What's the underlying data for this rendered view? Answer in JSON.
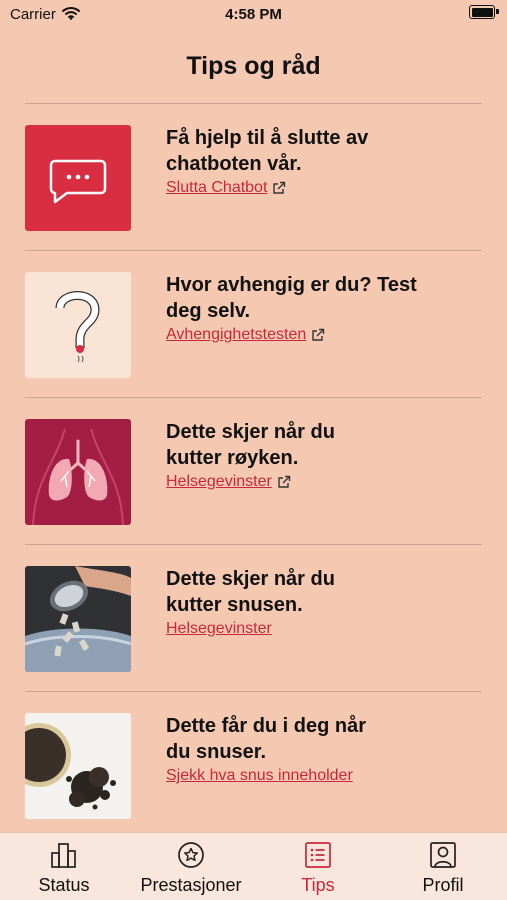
{
  "status_bar": {
    "carrier": "Carrier",
    "time": "4:58 PM"
  },
  "header": {
    "title": "Tips og råd"
  },
  "items": [
    {
      "heading_line1": "Få hjelp til å slutte av",
      "heading_line2": "chatboten vår.",
      "link": "Slutta Chatbot",
      "external": true,
      "image": "chat-bubble-icon"
    },
    {
      "heading_line1": "Hvor avhengig er du? Test",
      "heading_line2": "deg selv.",
      "link": "Avhengighetstesten",
      "external": true,
      "image": "cigarette-question-mark-illustration"
    },
    {
      "heading_line1": "Dette skjer når du",
      "heading_line2": "kutter røyken.",
      "link": "Helsegevinster",
      "external": true,
      "image": "lungs-illustration"
    },
    {
      "heading_line1": "Dette skjer når du",
      "heading_line2": "kutter snusen.",
      "link": "Helsegevinster",
      "external": false,
      "image": "snus-can-photo"
    },
    {
      "heading_line1": "Dette får du i deg når",
      "heading_line2": "du snuser.",
      "link": "Sjekk hva snus inneholder",
      "external": false,
      "image": "snus-tobacco-photo"
    }
  ],
  "tab_bar": {
    "tabs": [
      {
        "label": "Status",
        "icon": "bar-chart-icon",
        "active": false
      },
      {
        "label": "Prestasjoner",
        "icon": "star-badge-icon",
        "active": false
      },
      {
        "label": "Tips",
        "icon": "list-icon",
        "active": true
      },
      {
        "label": "Profil",
        "icon": "profile-icon",
        "active": false
      }
    ]
  },
  "colors": {
    "background": "#f5c9b1",
    "accent": "#c8283a",
    "tab_bar": "#f9e6dc"
  }
}
